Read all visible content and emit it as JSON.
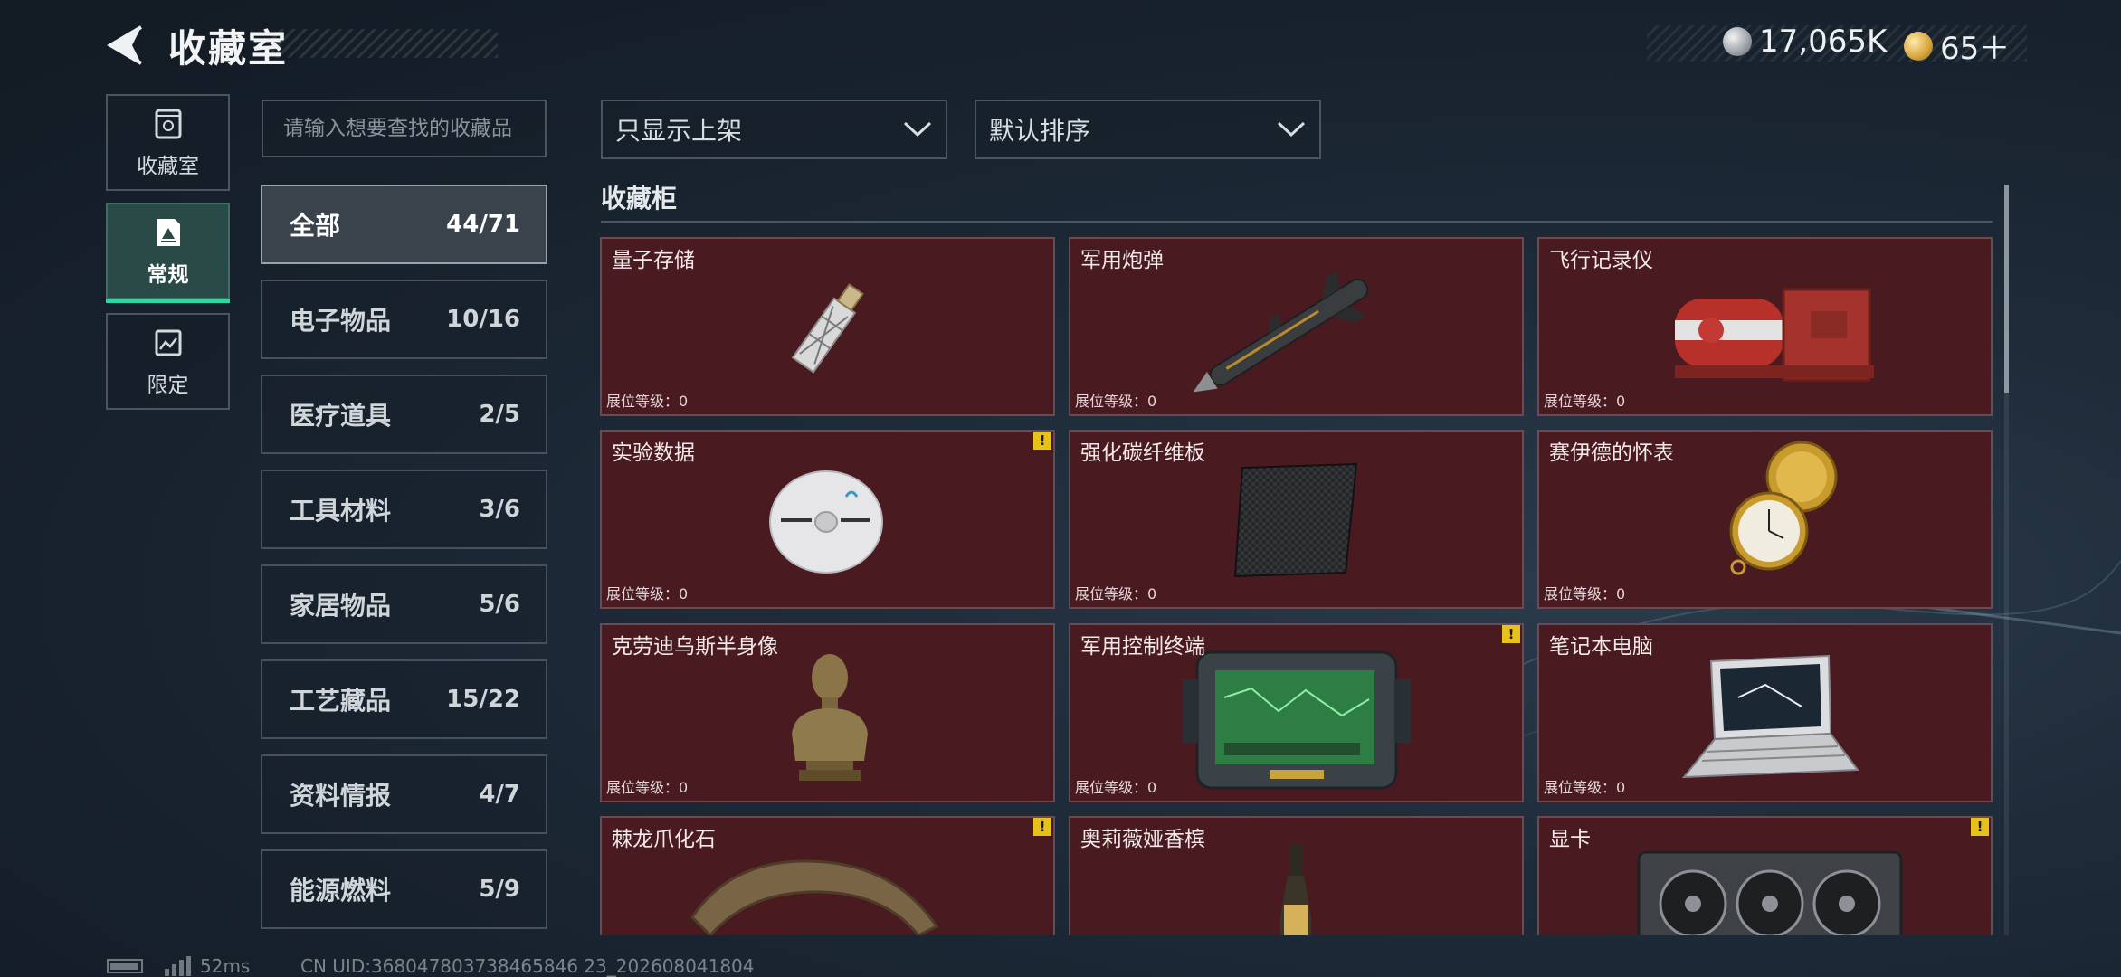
{
  "header": {
    "title": "收藏室"
  },
  "currency": [
    {
      "icon": "silver-coin-icon",
      "value": "17,065K"
    },
    {
      "icon": "gold-coin-icon",
      "value": "65＋"
    }
  ],
  "left_nav": [
    {
      "label": "收藏室",
      "icon": "collection-room-icon",
      "active": false
    },
    {
      "label": "常规",
      "icon": "regular-icon",
      "active": true
    },
    {
      "label": "限定",
      "icon": "limited-icon",
      "active": false
    }
  ],
  "search": {
    "placeholder": "请输入想要查找的收藏品"
  },
  "categories": [
    {
      "name": "全部",
      "count": "44/71",
      "active": true
    },
    {
      "name": "电子物品",
      "count": "10/16"
    },
    {
      "name": "医疗道具",
      "count": "2/5"
    },
    {
      "name": "工具材料",
      "count": "3/6"
    },
    {
      "name": "家居物品",
      "count": "5/6"
    },
    {
      "name": "工艺藏品",
      "count": "15/22"
    },
    {
      "name": "资料情报",
      "count": "4/7"
    },
    {
      "name": "能源燃料",
      "count": "5/9"
    }
  ],
  "filters": {
    "display": "只显示上架",
    "sort": "默认排序"
  },
  "section": {
    "title": "收藏柜"
  },
  "items": [
    {
      "name": "量子存储",
      "level": "展位等级：0",
      "alert": "",
      "icon": "usb-drive-icon"
    },
    {
      "name": "军用炮弹",
      "level": "展位等级：0",
      "alert": "",
      "icon": "missile-icon"
    },
    {
      "name": "飞行记录仪",
      "level": "展位等级：0",
      "alert": "",
      "icon": "flight-recorder-icon"
    },
    {
      "name": "实验数据",
      "level": "展位等级：0",
      "alert": "!",
      "icon": "disc-icon"
    },
    {
      "name": "强化碳纤维板",
      "level": "展位等级：0",
      "alert": "",
      "icon": "carbon-plate-icon"
    },
    {
      "name": "赛伊德的怀表",
      "level": "展位等级：0",
      "alert": "",
      "icon": "pocket-watch-icon"
    },
    {
      "name": "克劳迪乌斯半身像",
      "level": "展位等级：0",
      "alert": "",
      "icon": "bust-icon"
    },
    {
      "name": "军用控制终端",
      "level": "展位等级：0",
      "alert": "!",
      "icon": "control-terminal-icon"
    },
    {
      "name": "笔记本电脑",
      "level": "展位等级：0",
      "alert": "",
      "icon": "laptop-icon"
    },
    {
      "name": "棘龙爪化石",
      "level": "",
      "alert": "!",
      "icon": "claw-fossil-icon"
    },
    {
      "name": "奥莉薇娅香槟",
      "level": "",
      "alert": "",
      "icon": "champagne-icon"
    },
    {
      "name": "显卡",
      "level": "",
      "alert": "!",
      "icon": "graphics-card-icon"
    }
  ],
  "footer": {
    "ping": "52ms",
    "uid": "CN UID:368047803738465846 23_202608041804"
  },
  "colors": {
    "card_bg": "#4a1a21",
    "active_tab_accent": "#2fd6a1",
    "alert": "#e7c21b"
  }
}
